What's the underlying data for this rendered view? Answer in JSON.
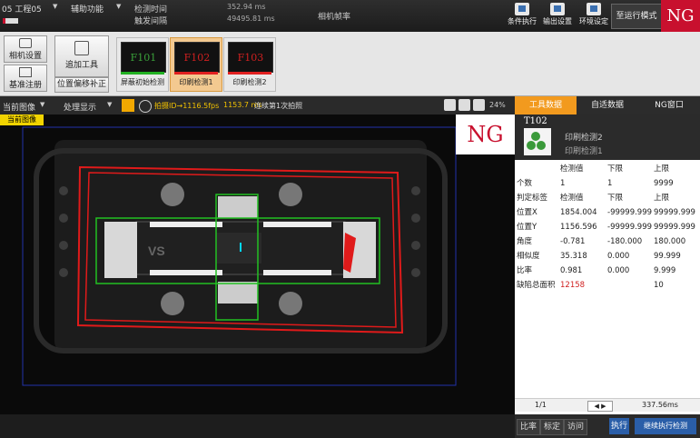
{
  "topbar": {
    "project": "05 工程05",
    "menu_aux": "辅助功能",
    "detect_time_label": "检测时间",
    "trigger_interval_label": "触发间隔",
    "detect_time_value": "352.94 ms",
    "trigger_interval_value": "49495.81 ms",
    "camera_fps_label": "相机帧率",
    "btn_condition": "条件执行",
    "btn_output": "输出设置",
    "btn_env": "环境设定",
    "btn_run_mode": "至运行模式",
    "ng_badge": "NG"
  },
  "toolrow": {
    "camera_settings": "相机设置",
    "reference_register": "基准注册",
    "add_tool": "追加工具",
    "position_offset": "位置偏移补正",
    "cards": [
      {
        "code": "F101",
        "caption": "屏蔽初始检测",
        "code_color": "#3aa03a",
        "bar_color": "#22b022",
        "selected": false
      },
      {
        "code": "F102",
        "caption": "印刷检测1",
        "code_color": "#d02020",
        "bar_color": "#e02020",
        "selected": true
      },
      {
        "code": "F103",
        "caption": "印刷检测2",
        "code_color": "#d02020",
        "bar_color": "#e02020",
        "selected": false
      }
    ]
  },
  "imgbar": {
    "current_image": "当前图像",
    "process_display": "处理显示",
    "status_text": "拍摄ID→1116.5fps",
    "time_text": "1153.7 ms",
    "continuous_text": "连续第1次拍照",
    "zoom": "24%"
  },
  "imgarea": {
    "tag": "当前图像",
    "ng": "NG",
    "chip_label": "VS"
  },
  "rpanel": {
    "tabs": [
      "工具数据",
      "自适数据",
      "NG窗口"
    ],
    "tool_id": "T102",
    "tool_name": "印刷检测2",
    "tool_type": "印刷检测1",
    "col_headers": [
      "检测值",
      "下限",
      "上限"
    ],
    "rows": [
      {
        "label": "个数",
        "value": "1",
        "low": "1",
        "high": "9999"
      },
      {
        "label": "判定标签",
        "value": "检测值",
        "low": "下限",
        "high": "上限"
      },
      {
        "label": "位置X",
        "value": "1854.004",
        "low": "-99999.999",
        "high": "99999.999"
      },
      {
        "label": "位置Y",
        "value": "1156.596",
        "low": "-99999.999",
        "high": "99999.999"
      },
      {
        "label": "角度",
        "value": "-0.781",
        "low": "-180.000",
        "high": "180.000"
      },
      {
        "label": "相似度",
        "value": "35.318",
        "low": "0.000",
        "high": "99.999"
      },
      {
        "label": "比率",
        "value": "0.981",
        "low": "0.000",
        "high": "9.999"
      },
      {
        "label": "缺陷总面积",
        "value": "12158",
        "low": "",
        "high": "10"
      }
    ],
    "page": "1/1",
    "time": "337.56ms",
    "btn_ratio": "比率",
    "btn_calib": "标定",
    "btn_access": "访问",
    "btn_exec": "执行",
    "btn_continue": "继续执行检测"
  },
  "colors": {
    "ng_red": "#c8102e",
    "accent_blue": "#2a5ea8",
    "green": "#22c022"
  }
}
